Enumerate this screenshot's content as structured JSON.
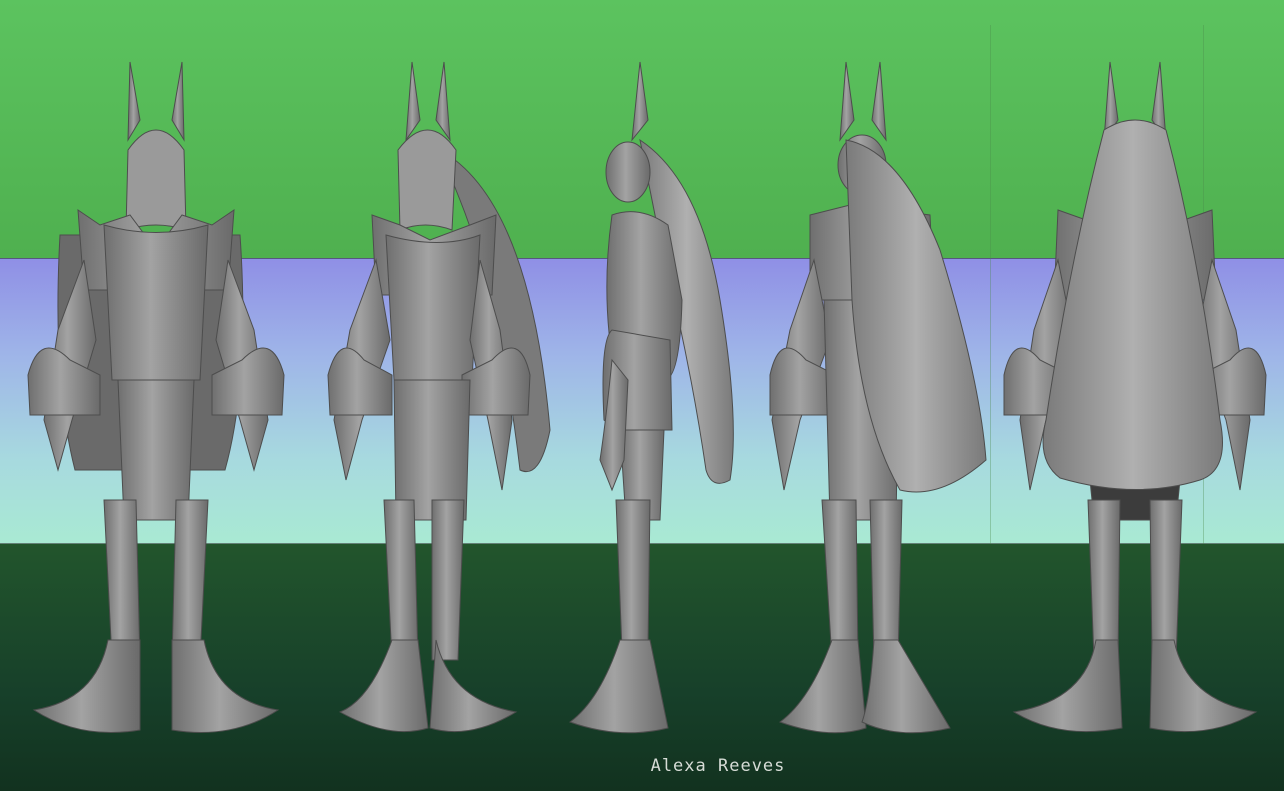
{
  "credit": {
    "artist": "Alexa Reeves"
  },
  "views": [
    {
      "id": "front",
      "icon": "figure-front-icon"
    },
    {
      "id": "three-quarter-front",
      "icon": "figure-three-quarter-icon"
    },
    {
      "id": "side",
      "icon": "figure-side-icon"
    },
    {
      "id": "three-quarter-back",
      "icon": "figure-three-quarter-back-icon"
    },
    {
      "id": "back",
      "icon": "figure-back-icon"
    }
  ],
  "colors": {
    "top_band": "#5cc35f",
    "middle_band": "#9fb6e8",
    "bottom_band": "#1a3a22",
    "sculpt": "#8c8c8c"
  }
}
